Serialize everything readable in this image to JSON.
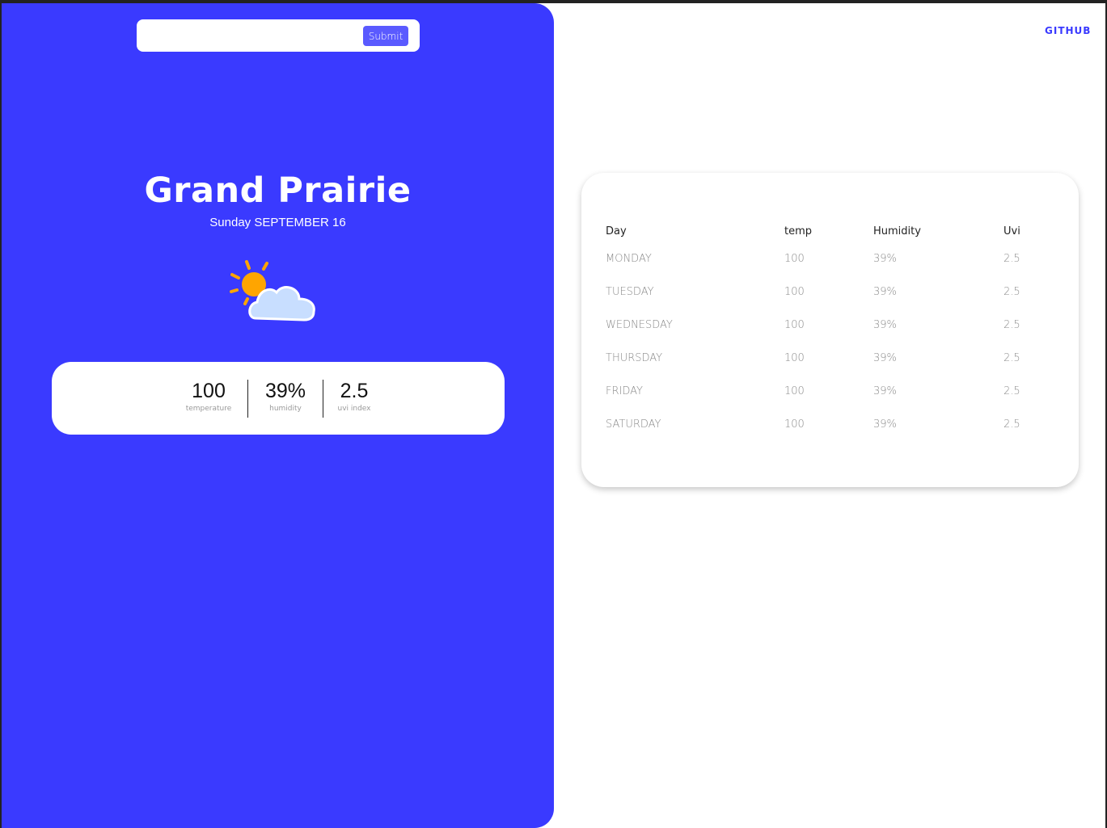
{
  "search": {
    "value": "",
    "placeholder": "",
    "submit_label": "Submit"
  },
  "header": {
    "github_label": "GITHUB"
  },
  "current": {
    "city": "Grand Prairie",
    "date": "Sunday SEPTEMBER 16",
    "icon": "partly-cloudy-icon",
    "stats": {
      "temperature": {
        "value": "100",
        "label": "temperature"
      },
      "humidity": {
        "value": "39%",
        "label": "humidity"
      },
      "uvi": {
        "value": "2.5",
        "label": "uvi index"
      }
    }
  },
  "forecast": {
    "headers": {
      "day": "Day",
      "temp": "temp",
      "humidity": "Humidity",
      "uvi": "Uvi"
    },
    "rows": [
      {
        "day": "MONDAY",
        "temp": "100",
        "humidity": "39%",
        "uvi": "2.5"
      },
      {
        "day": "TUESDAY",
        "temp": "100",
        "humidity": "39%",
        "uvi": "2.5"
      },
      {
        "day": "WEDNESDAY",
        "temp": "100",
        "humidity": "39%",
        "uvi": "2.5"
      },
      {
        "day": "THURSDAY",
        "temp": "100",
        "humidity": "39%",
        "uvi": "2.5"
      },
      {
        "day": "FRIDAY",
        "temp": "100",
        "humidity": "39%",
        "uvi": "2.5"
      },
      {
        "day": "SATURDAY",
        "temp": "100",
        "humidity": "39%",
        "uvi": "2.5"
      }
    ]
  },
  "colors": {
    "accent": "#3a3aff",
    "submit": "#5a5aff",
    "sun": "#ffa500",
    "cloud": "#c8deff"
  }
}
